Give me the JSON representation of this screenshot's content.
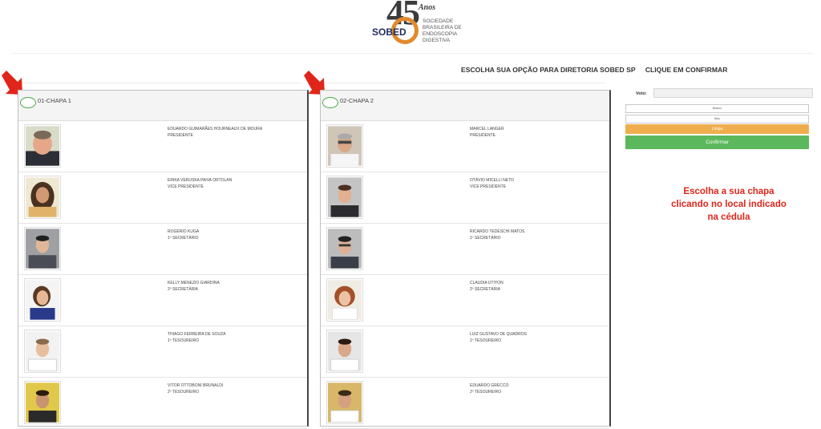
{
  "logo": {
    "number": "45",
    "anos": "Anos",
    "brand": "SOBED",
    "subtitle": [
      "SOCIEDADE",
      "BRASILEIRA DE",
      "ENDOSCOPIA",
      "DIGESTIVA"
    ],
    "colors": {
      "ring": "#e28a2d",
      "brand": "#1f2c5b"
    }
  },
  "header": {
    "title": "ESCOLHA SUA OPÇÃO PARA DIRETORIA SOBED SP",
    "instruction": "CLIQUE EM CONFIRMAR"
  },
  "chapas": [
    {
      "title": "01-CHAPA 1",
      "members": [
        {
          "name": "EDUARDO GUIMARÃES HOURNEAUX DE MOURA",
          "role": "PRESIDENTE"
        },
        {
          "name": "ERIKA VERUSKA PAIVA ORTOLAN",
          "role": "VICE PRESIDENTE"
        },
        {
          "name": "ROGÉRIO KUGA",
          "role": "1º SECRETÁRIO"
        },
        {
          "name": "KELLY MENEZIO GIARDINA",
          "role": "2º SECRETÁRIA"
        },
        {
          "name": "THIAGO FERREIRA DE SOUZA",
          "role": "1º TESOUREIRO"
        },
        {
          "name": "VITOR OTTOBONI BRUNALDI",
          "role": "2º TESOUREIRO"
        }
      ]
    },
    {
      "title": "02-CHAPA 2",
      "members": [
        {
          "name": "MARCEL LANGER",
          "role": "PRESIDENTE"
        },
        {
          "name": "OTÁVIO MICELLI NETO",
          "role": "VICE PRESIDENTE"
        },
        {
          "name": "RICARDO TEDESCHI MATOS",
          "role": "1º SECRETÁRIO"
        },
        {
          "name": "CLAUDIA UTIYON",
          "role": "2º SECRETÁRIA"
        },
        {
          "name": "LUIZ GUSTAVO DE QUADROS",
          "role": "1º TESOUREIRO"
        },
        {
          "name": "EDUARDO GRECCO",
          "role": "2º TESOUREIRO"
        }
      ]
    }
  ],
  "form": {
    "voto_label": "Voto:",
    "voto_value": "",
    "branco_label": "Branco",
    "nulo_label": "Nulo",
    "limpa_label": "Limpa",
    "confirmar_label": "Confirmar",
    "colors": {
      "limpa": "#efae4e",
      "confirmar": "#5cb85c"
    }
  },
  "note": "Escolha a sua chapa clicando no local indicado na cédula",
  "colors": {
    "arrow": "#e0261b",
    "radio_border": "#4aa84a"
  }
}
